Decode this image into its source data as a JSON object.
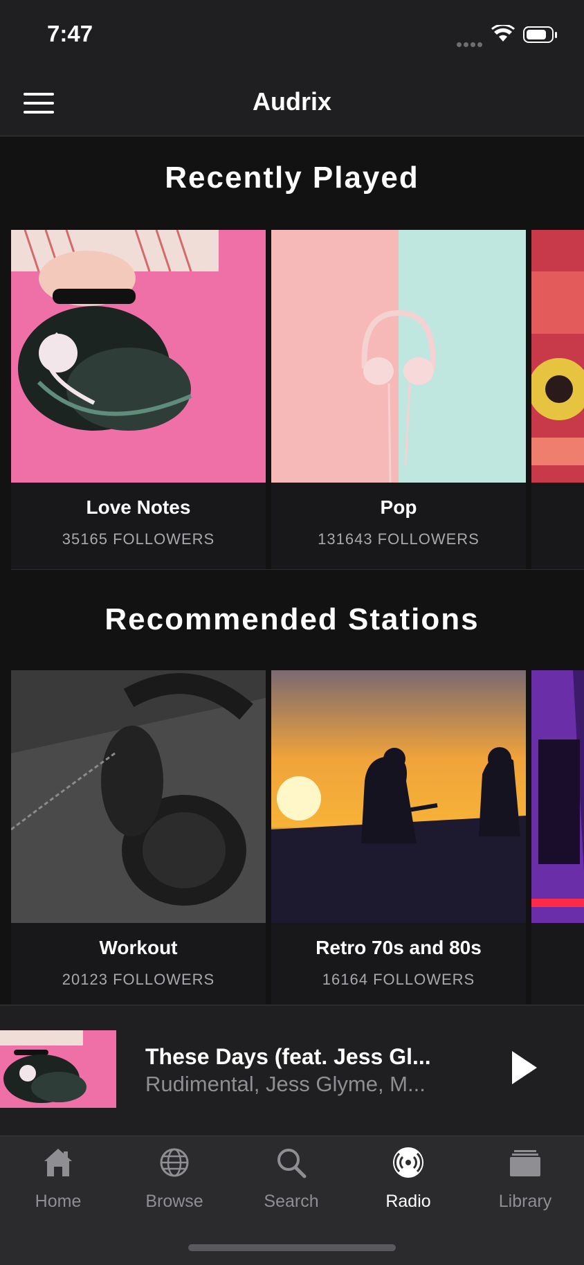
{
  "status_bar": {
    "time": "7:47"
  },
  "header": {
    "title": "Audrix"
  },
  "sections": [
    {
      "title": "Recently Played",
      "cards": [
        {
          "title": "Love Notes",
          "followers": "35165 FOLLOWERS"
        },
        {
          "title": "Pop",
          "followers": "131643 FOLLOWERS"
        }
      ]
    },
    {
      "title": "Recommended Stations",
      "cards": [
        {
          "title": "Workout",
          "followers": "20123 FOLLOWERS"
        },
        {
          "title": "Retro 70s and 80s",
          "followers": "16164 FOLLOWERS"
        }
      ]
    }
  ],
  "now_playing": {
    "title": "These Days (feat. Jess Gl...",
    "artist": "Rudimental, Jess Glyme, M..."
  },
  "tabs": [
    {
      "label": "Home",
      "icon": "home-icon"
    },
    {
      "label": "Browse",
      "icon": "globe-icon"
    },
    {
      "label": "Search",
      "icon": "search-icon"
    },
    {
      "label": "Radio",
      "icon": "radio-icon",
      "active": true
    },
    {
      "label": "Library",
      "icon": "library-icon"
    }
  ],
  "colors": {
    "background": "#121213",
    "bar": "#1f1f21",
    "accent_pink": "#ef6fa7",
    "muted": "#8e8e93"
  }
}
